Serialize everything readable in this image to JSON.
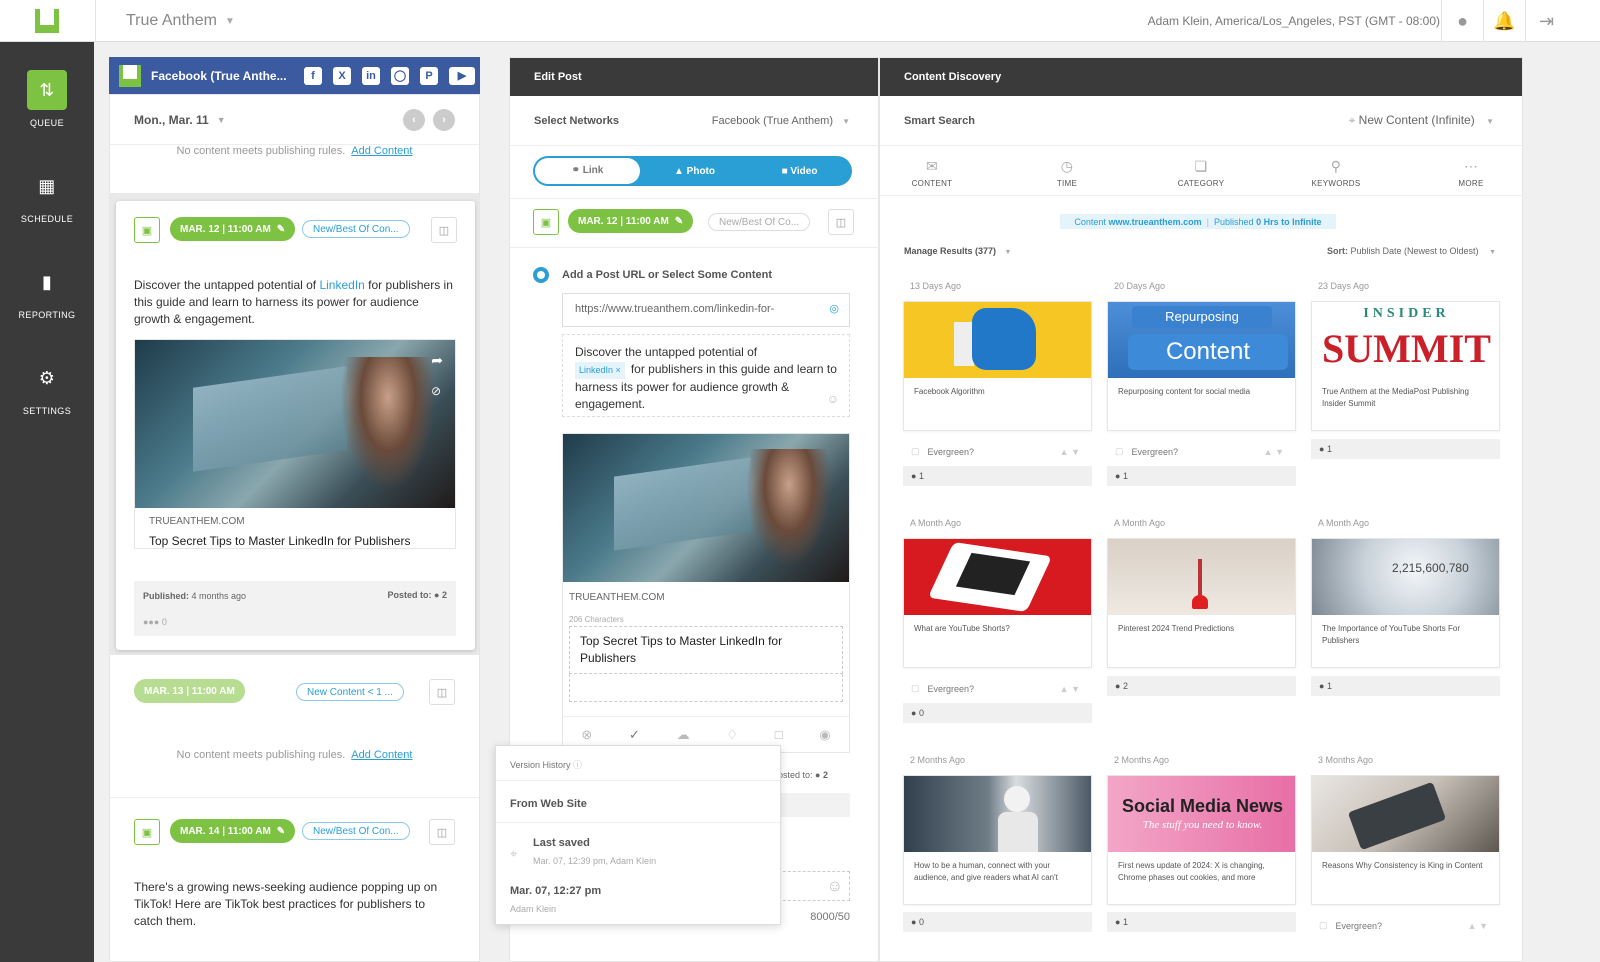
{
  "app": {
    "brand": "True Anthem",
    "user": "Adam Klein, America/Los_Angeles, PST (GMT - 08:00)"
  },
  "nav": [
    {
      "label": "QUEUE",
      "icon": "up-down-arrows-icon"
    },
    {
      "label": "SCHEDULE",
      "icon": "calendar-icon"
    },
    {
      "label": "REPORTING",
      "icon": "bar-chart-icon"
    },
    {
      "label": "SETTINGS",
      "icon": "gear-icon"
    }
  ],
  "queue": {
    "account": "Facebook (True Anthe...",
    "date": "Mon., Mar. 11",
    "no_content": "No content meets publishing rules.",
    "add_content": "Add Content",
    "post1": {
      "time": "MAR. 12 | 11:00 AM",
      "rule": "New/Best Of Con...",
      "text_a": "Discover the untapped potential of ",
      "text_link": "LinkedIn",
      "text_b": " for publishers in this guide and learn to harness its power for audience growth & engagement.",
      "domain": "TRUEANTHEM.COM",
      "headline": "Top Secret Tips to Master LinkedIn for Publishers",
      "published_label": "Published:",
      "published_value": "4 months ago",
      "posted_label": "Posted to:",
      "posted_count": "2",
      "reactions": "0"
    },
    "post2": {
      "time": "MAR. 13 | 11:00 AM",
      "rule": "New Content < 1 ..."
    },
    "post3": {
      "time": "MAR. 14 | 11:00 AM",
      "rule": "New/Best Of Con...",
      "text": "There's a growing news-seeking audience popping up on TikTok! Here are TikTok best practices for publishers to catch them."
    }
  },
  "edit": {
    "title": "Edit Post",
    "select_networks": "Select Networks",
    "network": "Facebook (True Anthem)",
    "seg": [
      "Link",
      "Photo",
      "Video"
    ],
    "time": "MAR. 12 | 11:00 AM",
    "rule": "New/Best Of Co...",
    "url_label": "Add a Post URL or Select Some Content",
    "url": "https://www.trueanthem.com/linkedin-for-",
    "msg_a": "Discover the untapped potential of",
    "chip": "LinkedIn",
    "msg_b": "for publishers in this guide and learn to harness its power for audience growth & engagement.",
    "domain": "TRUEANTHEM.COM",
    "chars": "206 Characters",
    "headline": "Top Secret Tips to Master LinkedIn for Publishers",
    "posted_to": "osted to:",
    "posted_count": "2",
    "counter": "8000/50"
  },
  "version": {
    "title": "Version History",
    "source": "From Web Site",
    "last_saved": "Last saved",
    "last_saved_meta": "Mar. 07, 12:39 pm, Adam Klein",
    "v2": "Mar. 07, 12:27 pm",
    "v2_meta": "Adam Klein"
  },
  "discovery": {
    "title": "Content Discovery",
    "smart_search": "Smart Search",
    "filter": "New Content (Infinite)",
    "tools": [
      "CONTENT",
      "TIME",
      "CATEGORY",
      "KEYWORDS",
      "MORE"
    ],
    "tag_a": "Content ",
    "tag_b": "www.trueanthem.com",
    "tag_c": "Published ",
    "tag_d": "0 Hrs to Infinite",
    "manage": "Manage Results (377)",
    "sort_label": "Sort:",
    "sort_value": "Publish Date (Newest to Oldest)",
    "evergreen": "Evergreen?",
    "cards": [
      {
        "ago": "13 Days Ago",
        "caption": "Facebook Algorithm",
        "count": "1"
      },
      {
        "ago": "20 Days Ago",
        "caption": "Repurposing content for social media",
        "count": "1",
        "overlay": "Content",
        "overlay2": "Repurposing"
      },
      {
        "ago": "23 Days Ago",
        "caption": "True Anthem at the MediaPost Publishing Insider Summit",
        "count": "1",
        "overlay": "SUMMIT",
        "overlay2": "INSIDER"
      },
      {
        "ago": "A Month Ago",
        "caption": "What are YouTube Shorts?",
        "count": "0"
      },
      {
        "ago": "A Month Ago",
        "caption": "Pinterest 2024 Trend Predictions",
        "count": "2"
      },
      {
        "ago": "A Month Ago",
        "caption": "The Importance of YouTube Shorts For Publishers",
        "count": "1",
        "overlay": "2,215,600,780"
      },
      {
        "ago": "2 Months Ago",
        "caption": "How to be a human, connect with your audience, and give readers what AI can't",
        "count": "0"
      },
      {
        "ago": "2 Months Ago",
        "caption": "First news update of 2024: X is changing, Chrome phases out cookies, and more",
        "count": "1",
        "overlay": "Social Media News",
        "overlay2": "The stuff you need to know."
      },
      {
        "ago": "3 Months Ago",
        "caption": "Reasons Why Consistency is King in Content",
        "count": ""
      }
    ]
  },
  "colors": {
    "green": "#7dc242",
    "blue": "#2a9fd6",
    "facebook": "#3c5aa0",
    "dark": "#3a3a3a"
  }
}
